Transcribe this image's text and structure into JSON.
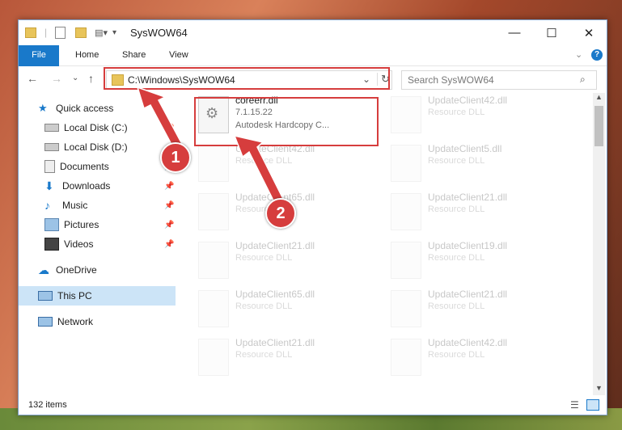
{
  "window": {
    "title": "SysWOW64"
  },
  "ribbon": {
    "tabs": [
      "File",
      "Home",
      "Share",
      "View"
    ]
  },
  "address": {
    "path": "C:\\Windows\\SysWOW64"
  },
  "search": {
    "placeholder": "Search SysWOW64"
  },
  "sidebar": {
    "items": [
      {
        "label": "Quick access",
        "icon": "star-icon"
      },
      {
        "label": "Local Disk (C:)",
        "icon": "drive-icon"
      },
      {
        "label": "Local Disk (D:)",
        "icon": "drive-icon"
      },
      {
        "label": "Documents",
        "icon": "documents-icon"
      },
      {
        "label": "Downloads",
        "icon": "download-icon"
      },
      {
        "label": "Music",
        "icon": "music-icon"
      },
      {
        "label": "Pictures",
        "icon": "pictures-icon"
      },
      {
        "label": "Videos",
        "icon": "videos-icon"
      },
      {
        "label": "OneDrive",
        "icon": "cloud-icon"
      },
      {
        "label": "This PC",
        "icon": "computer-icon"
      },
      {
        "label": "Network",
        "icon": "network-icon"
      }
    ]
  },
  "files": [
    {
      "name": "coreerr.dll",
      "line2": "7.1.15.22",
      "line3": "Autodesk Hardcopy C..."
    },
    {
      "name": "UpdateClient42.dll",
      "line2": "Resource DLL"
    },
    {
      "name": "UpdateClient42.dll",
      "line2": "Resource DLL"
    },
    {
      "name": "UpdateClient5.dll",
      "line2": "Resource DLL"
    },
    {
      "name": "UpdateClient65.dll",
      "line2": "Resource DLL"
    },
    {
      "name": "UpdateClient21.dll",
      "line2": "Resource DLL"
    },
    {
      "name": "UpdateClient21.dll",
      "line2": "Resource DLL"
    },
    {
      "name": "UpdateClient19.dll",
      "line2": "Resource DLL"
    },
    {
      "name": "UpdateClient65.dll",
      "line2": "Resource DLL"
    },
    {
      "name": "UpdateClient21.dll",
      "line2": "Resource DLL"
    },
    {
      "name": "UpdateClient21.dll",
      "line2": "Resource DLL"
    },
    {
      "name": "UpdateClient42.dll",
      "line2": "Resource DLL"
    }
  ],
  "status": {
    "item_count": "132 items"
  },
  "callouts": [
    "1",
    "2"
  ],
  "colors": {
    "accent": "#1979ca",
    "highlight": "#d63d3d",
    "selection": "#cce4f7"
  }
}
